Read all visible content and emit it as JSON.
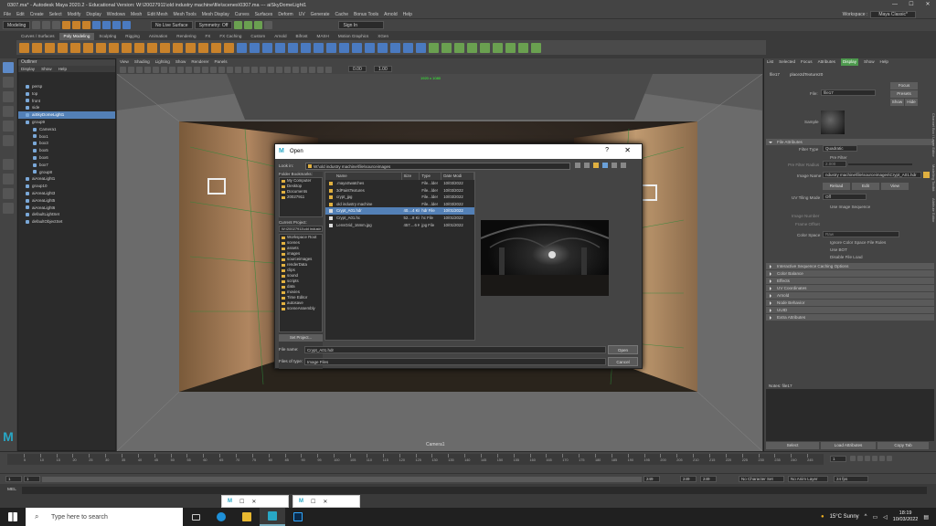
{
  "window": {
    "title": "0307.ma* - Autodesk Maya 2020.2 - Educational Version: W:\\20027911\\old industry machine\\file\\scenes\\0307.ma  ---  aiSkyDomeLight1",
    "minimize": "—",
    "maximize": "☐",
    "close": "✕"
  },
  "menubar": {
    "items": [
      "File",
      "Edit",
      "Create",
      "Select",
      "Modify",
      "Display",
      "Windows",
      "Mesh",
      "Edit Mesh",
      "Mesh Tools",
      "Mesh Display",
      "Curves",
      "Surfaces",
      "Deform",
      "UV",
      "Generate",
      "Cache",
      "Bonus Tools",
      "Arnold",
      "Help"
    ],
    "workspace_label": "Workspace :",
    "workspace_value": "Maya Classic*"
  },
  "statusline": {
    "mode": "Modeling",
    "live_surface": "No Live Surface",
    "symmetry": "Symmetry: Off",
    "signin": "Sign In"
  },
  "shelf_tabs": [
    "Curves / Surfaces",
    "Poly Modeling",
    "Sculpting",
    "Rigging",
    "Animation",
    "Rendering",
    "FX",
    "FX Caching",
    "Custom",
    "Arnold",
    "Bifrost",
    "MASH",
    "Motion Graphics",
    "XGen"
  ],
  "shelf_active": 1,
  "outliner": {
    "title": "Outliner",
    "menu": [
      "Display",
      "Show",
      "Help"
    ],
    "items": [
      {
        "label": "persp",
        "indent": 1,
        "sel": false
      },
      {
        "label": "top",
        "indent": 1,
        "sel": false
      },
      {
        "label": "front",
        "indent": 1,
        "sel": false
      },
      {
        "label": "side",
        "indent": 1,
        "sel": false
      },
      {
        "label": "aiSkyDomeLight1",
        "indent": 1,
        "sel": true
      },
      {
        "label": "group9",
        "indent": 1,
        "sel": false
      },
      {
        "label": "Camera1",
        "indent": 2,
        "sel": false
      },
      {
        "label": "box1",
        "indent": 2,
        "sel": false
      },
      {
        "label": "box3",
        "indent": 2,
        "sel": false
      },
      {
        "label": "box5",
        "indent": 2,
        "sel": false
      },
      {
        "label": "box6",
        "indent": 2,
        "sel": false
      },
      {
        "label": "box7",
        "indent": 2,
        "sel": false
      },
      {
        "label": "group8",
        "indent": 2,
        "sel": false
      },
      {
        "label": "aiAreaLight1",
        "indent": 1,
        "sel": false
      },
      {
        "label": "group10",
        "indent": 1,
        "sel": false
      },
      {
        "label": "aiAreaLight3",
        "indent": 1,
        "sel": false
      },
      {
        "label": "aiAreaLight5",
        "indent": 1,
        "sel": false
      },
      {
        "label": "aiAreaLight6",
        "indent": 1,
        "sel": false
      },
      {
        "label": "defaultLightSet",
        "indent": 1,
        "sel": false
      },
      {
        "label": "defaultObjectSet",
        "indent": 1,
        "sel": false
      }
    ]
  },
  "viewport": {
    "menu": [
      "View",
      "Shading",
      "Lighting",
      "Show",
      "Renderer",
      "Panels"
    ],
    "exposure": "0.00",
    "gamma": "1.00",
    "resolution_label": "1920 x 1080",
    "camera_label": "Camera1"
  },
  "attribute_editor": {
    "menu": [
      "List",
      "Selected",
      "Focus",
      "Attributes",
      "Display",
      "Show",
      "Help"
    ],
    "display_highlight": "Display",
    "tab": "file17",
    "node_type_tab": "place2dTexture20",
    "focus_btn": "Focus",
    "presets_btn": "Presets",
    "show_btn": "Show",
    "hide_btn": "Hide",
    "file_label": "File:",
    "file_value": "file17",
    "sample_label": "Sample",
    "sections_top": "File Attributes",
    "filter_type_label": "Filter Type",
    "filter_type_value": "Quadratic",
    "pre_filter": "Pre Filter",
    "pre_filter_radius": "Pre Filter Radius",
    "pre_filter_radius_value": "2.000",
    "image_name_label": "Image Name",
    "image_name_value": "ndustry machine\\file\\sourceimages\\Crypt_A01.hdr",
    "reload": "Reload",
    "edit": "Edit",
    "view": "View",
    "uv_tiling_label": "UV Tiling Mode",
    "uv_tiling_value": "Off",
    "use_image_sequence": "Use Image Sequence",
    "image_number": "Image Number",
    "frame_offset": "Frame Offset",
    "color_space_label": "Color Space",
    "color_space_value": "Raw",
    "ignore_cs": "Ignore Color Space File Rules",
    "use_bot": "Use BOT",
    "disable_file_load": "Disable File Load",
    "sections": [
      "Interactive Sequence Caching Options",
      "Color Balance",
      "Effects",
      "UV Coordinates",
      "Arnold",
      "Node Behavior",
      "UUID",
      "Extra Attributes"
    ],
    "notes_label": "Notes: file17",
    "select_btn": "Select",
    "load_attr_btn": "Load Attributes",
    "copy_tab_btn": "Copy Tab",
    "side_tabs": [
      "Channel Box / Layer Editor",
      "Modelling Toolkit",
      "Attribute Editor"
    ]
  },
  "timeline": {
    "ticks": [
      "5",
      "10",
      "15",
      "20",
      "25",
      "30",
      "35",
      "40",
      "45",
      "50",
      "55",
      "60",
      "65",
      "70",
      "75",
      "80",
      "85",
      "90",
      "95",
      "100",
      "105",
      "110",
      "115",
      "120",
      "125",
      "130",
      "135",
      "140",
      "145",
      "150",
      "155",
      "160",
      "165",
      "170",
      "175",
      "180",
      "185",
      "190",
      "195",
      "200",
      "205",
      "210",
      "215",
      "220",
      "225",
      "230",
      "235",
      "240",
      "245"
    ],
    "current_frame": "1",
    "range_start": "1",
    "range_start2": "1",
    "range_end": "249",
    "range_end2": "249",
    "frame_field": "249",
    "character_set": "No Character Set",
    "anim_layer": "No Anim Layer",
    "fps": "24 fps"
  },
  "mel_label": "MEL",
  "dialog": {
    "title": "Open",
    "help": "?",
    "close": "✕",
    "look_in_label": "Look in:",
    "look_in_path": "W:\\old industry machine\\file\\sourceimages",
    "folder_bookmarks_label": "Folder Bookmarks:",
    "bookmarks": [
      "My Computer",
      "Desktop",
      "Documents",
      "20027911"
    ],
    "current_project_label": "Current Project:",
    "current_project_value": "W:\\20027911\\old industr",
    "project_folders": [
      "Workspace Root",
      "scenes",
      "assets",
      "images",
      "sourceimages",
      "renderData",
      "clips",
      "sound",
      "scripts",
      "data",
      "movies",
      "Time Editor",
      "autosave",
      "sceneAssembly"
    ],
    "set_project": "Set Project...",
    "columns": [
      "Name",
      "Size",
      "Type",
      "Date Modi"
    ],
    "files": [
      {
        "name": ".mayaSwatches",
        "size": "",
        "type": "File...lder",
        "date": "10/03/2022",
        "folder": true,
        "sel": false
      },
      {
        "name": "3dPaintTextures",
        "size": "",
        "type": "File...lder",
        "date": "10/03/2022",
        "folder": true,
        "sel": false
      },
      {
        "name": "crypt_jpg",
        "size": "",
        "type": "File...lder",
        "date": "10/03/2022",
        "folder": true,
        "sel": false
      },
      {
        "name": "old industry machine",
        "size": "",
        "type": "File...lder",
        "date": "10/03/2022",
        "folder": true,
        "sel": false
      },
      {
        "name": "Crypt_A01.hdr",
        "size": "40....4 KiB",
        "type": "hdr File",
        "date": "10/01/2022",
        "folder": false,
        "sel": true
      },
      {
        "name": "Crypt_A01.hc",
        "size": "52....8 KiB",
        "type": "hc File",
        "date": "10/01/2022",
        "folder": false,
        "sel": false
      },
      {
        "name": "LensGrid_16mm.jpg",
        "size": "457....6 KiB",
        "type": "jpg File",
        "date": "10/01/2022",
        "folder": false,
        "sel": false
      }
    ],
    "file_name_label": "File name:",
    "file_name_value": "Crypt_A01.hdr",
    "file_type_label": "Files of type:",
    "file_type_value": "Image Files",
    "open_btn": "Open",
    "cancel_btn": "Cancel"
  },
  "taskbar": {
    "search_placeholder": "Type here to search",
    "weather": "15°C  Sunny",
    "time": "18:19",
    "date": "10/03/2022"
  }
}
